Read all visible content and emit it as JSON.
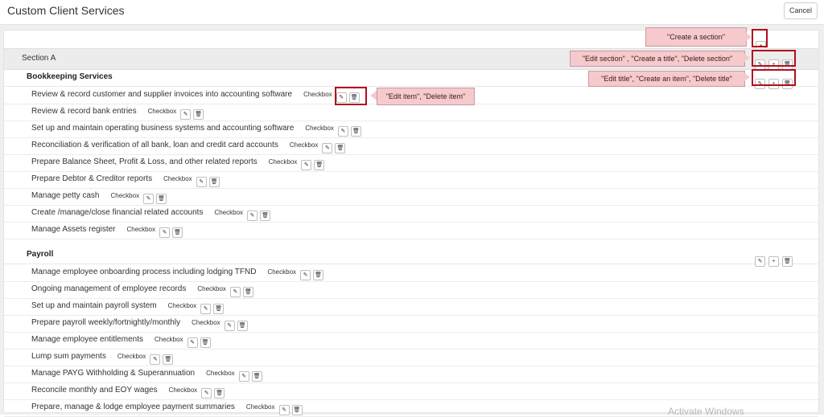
{
  "header": {
    "title": "Custom Client Services",
    "cancel_label": "Cancel"
  },
  "section": {
    "label": "Section A"
  },
  "titles": [
    {
      "label": "Bookkeeping Services",
      "items": [
        {
          "text": "Review & record customer and supplier invoices into accounting software",
          "type": "Checkbox"
        },
        {
          "text": "Review & record bank entries",
          "type": "Checkbox"
        },
        {
          "text": "Set up and maintain operating business systems and accounting software",
          "type": "Checkbox"
        },
        {
          "text": "Reconciliation & verification of all bank, loan and credit card accounts",
          "type": "Checkbox"
        },
        {
          "text": "Prepare Balance Sheet, Profit & Loss, and other related reports",
          "type": "Checkbox"
        },
        {
          "text": "Prepare Debtor & Creditor reports",
          "type": "Checkbox"
        },
        {
          "text": "Manage petty cash",
          "type": "Checkbox"
        },
        {
          "text": "Create /manage/close financial related accounts",
          "type": "Checkbox"
        },
        {
          "text": "Manage Assets register",
          "type": "Checkbox"
        }
      ]
    },
    {
      "label": "Payroll",
      "items": [
        {
          "text": "Manage employee onboarding process including lodging TFND",
          "type": "Checkbox"
        },
        {
          "text": "Ongoing management of employee records",
          "type": "Checkbox"
        },
        {
          "text": "Set up and maintain payroll system",
          "type": "Checkbox"
        },
        {
          "text": "Prepare payroll weekly/fortnightly/monthly",
          "type": "Checkbox"
        },
        {
          "text": "Manage employee entitlements",
          "type": "Checkbox"
        },
        {
          "text": "Lump sum payments",
          "type": "Checkbox"
        },
        {
          "text": "Manage PAYG Withholding & Superannuation",
          "type": "Checkbox"
        },
        {
          "text": "Reconcile monthly and EOY wages",
          "type": "Checkbox"
        },
        {
          "text": "Prepare, manage & lodge employee payment summaries",
          "type": "Checkbox"
        }
      ]
    }
  ],
  "annotations": {
    "create_section": "\"Create a section\"",
    "section_actions": "\"Edit section\" , \"Create a title\", \"Delete section\"",
    "title_actions": "\"Edit title\", \"Create an item\", \"Delete title\"",
    "item_actions": "\"Edit item\", \"Delete item\""
  },
  "watermark": "Activate Windows",
  "icons": {
    "edit": "pencil-icon",
    "add": "plus-icon",
    "delete": "trash-icon"
  },
  "colors": {
    "highlight": "#b20d1c",
    "tooltip_bg": "#f6c9cc"
  }
}
